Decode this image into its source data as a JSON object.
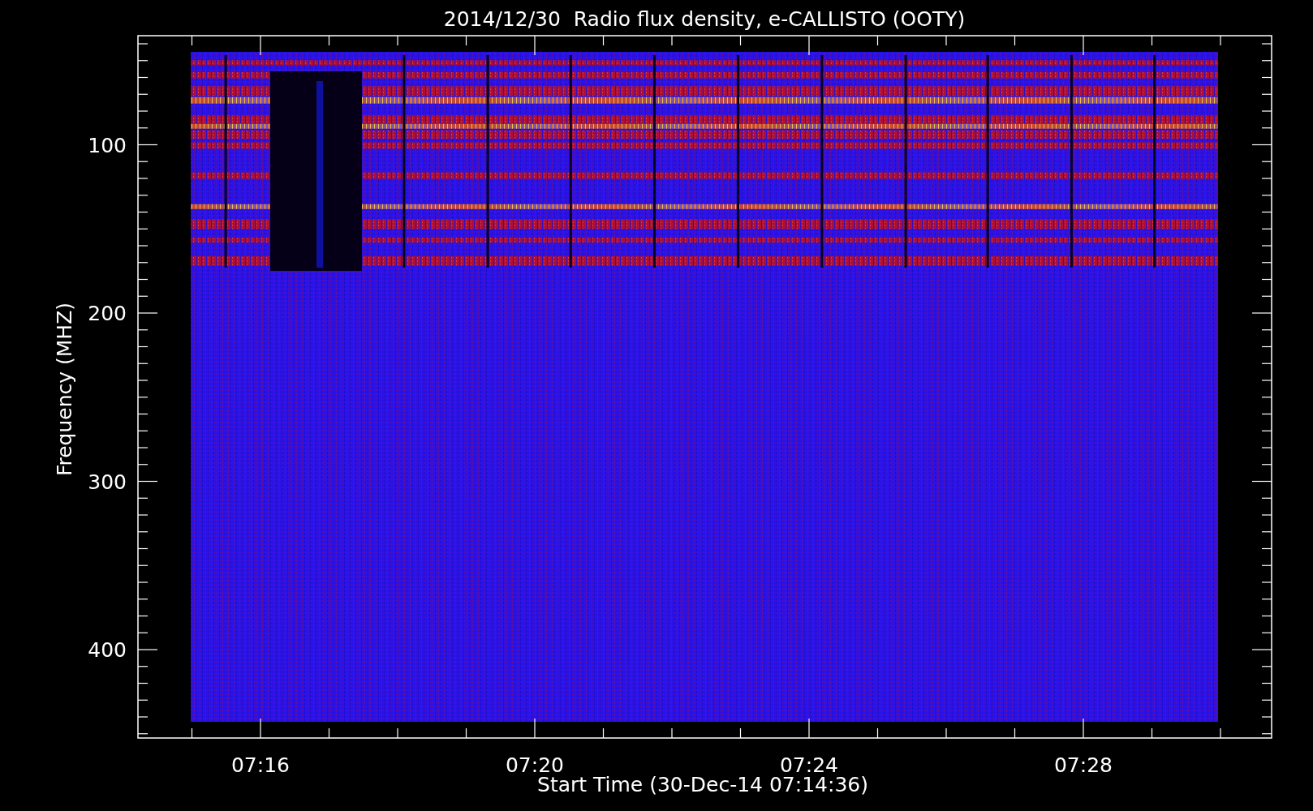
{
  "title": "2014/12/30  Radio flux density, e-CALLISTO (OOTY)",
  "y_axis": {
    "label": "Frequency (MHZ)",
    "ticks": [
      "100",
      "200",
      "300",
      "400"
    ]
  },
  "x_axis": {
    "label": "Start Time (30-Dec-14 07:14:36)",
    "ticks": [
      "07:16",
      "07:20",
      "07:24",
      "07:28"
    ]
  }
}
